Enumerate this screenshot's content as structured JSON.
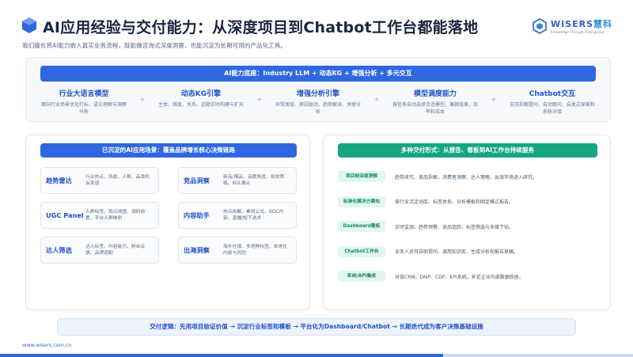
{
  "header": {
    "title": "AI应用经验与交付能力：从深度项目到Chatbot工作台都能落地",
    "subtitle": "我们擅长将AI能力嵌入真实业务流程，既能做咨询式深度洞察，也能沉淀为长期可用的产品化工具。",
    "brand_name": "WISERS",
    "brand_cn": "慧科",
    "brand_tagline": "Knowledge Through Intelligence",
    "brand_color": "#2d5fc4"
  },
  "capabilities": {
    "banner": "AI能力底座：Industry  LLM  +  动态KG  +  增强分析  +  多元交互",
    "plus_symbol": "+",
    "items": [
      {
        "name": "行业大语言模型",
        "desc": "面向行业场景优化打标、语义理解与洞察分析"
      },
      {
        "name": "动态KG引擎",
        "desc": "主体、维度、关系、话题实时构建与扩充"
      },
      {
        "name": "增强分析引擎",
        "desc": "异常发现、原因驱动、趋势解读、关联分析"
      },
      {
        "name": "模型调度能力",
        "desc": "按任务自动选择合适模型，兼顾效果、效率和成本"
      },
      {
        "name": "Chatbot交互",
        "desc": "支持拆解提问、自动跟问、启发式探索和系统对接"
      }
    ]
  },
  "scenarios": {
    "heading": "已沉淀的AI应用场景：覆盖品牌增长核心决策链路",
    "items": [
      {
        "name": "趋势雷达",
        "desc": "行业热点、场景、人群、品类机会发现"
      },
      {
        "name": "竞品洞察",
        "desc": "新品/爆品、话题角度、投放策略、KOL偏点"
      },
      {
        "name": "UGC Panel",
        "desc": "人群标签、观点地图、调研前置，平台人群映射"
      },
      {
        "name": "内容助手",
        "desc": "热点拆解、素材公式、BGC内容，直播/短下选术"
      },
      {
        "name": "达人筛选",
        "desc": "达人标签、内容能力、粉丝反馈、品牌适配"
      },
      {
        "name": "出海洞察",
        "desc": "海外社媒、多语种标签、本地化内容与风险"
      }
    ]
  },
  "delivery": {
    "heading": "多种交付形式：从报告、看板到AI工作台持续服务",
    "items": [
      {
        "tag": "项目制深度洞察",
        "desc": "趋势研究、竞品拆解、消费者洞察、达人策略、出海市场进入研究。"
      },
      {
        "tag": "标准化解决方案包",
        "desc": "按行业沉淀词库、标签体系、分析模板和固定模式报告。"
      },
      {
        "tag": "Dashboard看板",
        "desc": "实时监测、趋势预警、竞品追踪、标签筛选与多维下钻。"
      },
      {
        "tag": "Chatbot工作台",
        "desc": "业务人员可自助提问、调用知识库、生成分析和报告草稿。"
      },
      {
        "tag": "系统/API集成",
        "desc": "对接CRM、DMP、CDP、KPI系统，补足企业内部数据底座。"
      }
    ]
  },
  "logic": {
    "text": "交付逻辑：先用项目验证价值 → 沉淀行业标签和模板 → 平台化为Dashboard/Chatbot → 长期迭代成为客户决策基础设施"
  },
  "footer": {
    "url": "www.wisers.com.cn"
  },
  "colors": {
    "primary_blue": "#2f67e0",
    "accent_green": "#15a583",
    "heading_dark": "#1a2540"
  }
}
